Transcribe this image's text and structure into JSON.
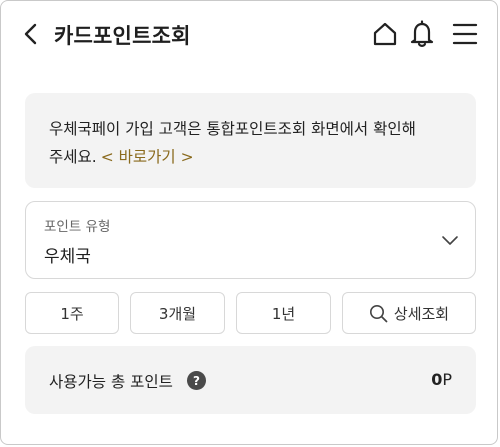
{
  "header": {
    "title": "카드포인트조회",
    "icons": [
      "back-arrow-icon",
      "home-icon",
      "bell-icon",
      "menu-icon"
    ]
  },
  "notice": {
    "text_line1": "우체국페이 가입 고객은 통합포인트조회 화면에서 확인해",
    "text_line2": "주세요.",
    "link": "< 바로가기 >",
    "link_color": "#8a6a1d"
  },
  "point_type": {
    "label": "포인트 유형",
    "value": "우체국"
  },
  "period_buttons": {
    "week": "1주",
    "three_months": "3개월",
    "year": "1년",
    "detail_search": "상세조회"
  },
  "points": {
    "label": "사용가능 총 포인트",
    "help_icon": "?",
    "value": "0",
    "unit": "P"
  }
}
